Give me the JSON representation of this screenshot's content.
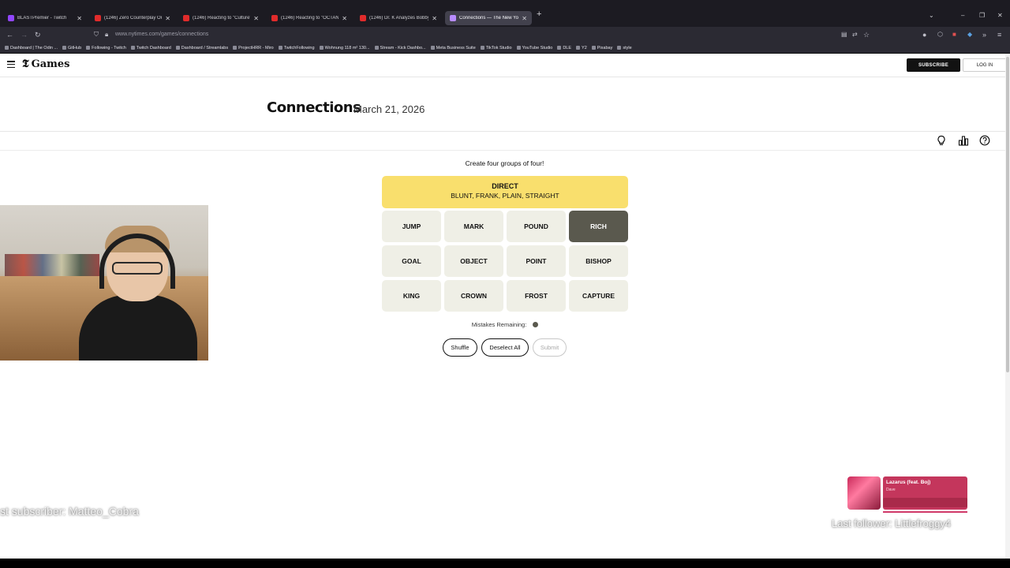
{
  "browser": {
    "tabs": [
      {
        "label": "BLASTPremier - Twitch",
        "icon": "twitch-icon",
        "active": false
      },
      {
        "label": "(1246) Zero Counterplay Oneshi",
        "icon": "youtube-icon",
        "active": false
      },
      {
        "label": "(1246) Reacting to \"Culture\" by",
        "icon": "youtube-icon",
        "active": false
      },
      {
        "label": "(1246) Reacting to \"OCTANE\" b",
        "icon": "youtube-icon",
        "active": false
      },
      {
        "label": "(1246) Dr. K Analyzes Bobby Le",
        "icon": "youtube-icon",
        "active": false
      },
      {
        "label": "Connections — The New York T",
        "icon": "nyt-games-icon",
        "active": true
      }
    ],
    "url": "www.nytimes.com/games/connections",
    "bookmarks": [
      "Dashboard | The Odin ...",
      "GitHub",
      "Following - Twitch",
      "Twitch Dashboard",
      "Dashboard / Streamlabs",
      "ProjectHRR - Miro",
      "TwitchFollowing",
      "Wohnung 118 m² 130...",
      "Stream - Kick Dashbo...",
      "Meta Business Suite",
      "TikTok Studio",
      "YouTube Studio",
      "DLE",
      "Y2",
      "Pixabay",
      "style"
    ]
  },
  "header": {
    "logo_text": "Games",
    "subscribe_label": "SUBSCRIBE",
    "login_label": "LOG IN"
  },
  "game": {
    "title": "Connections",
    "date": "March 21, 2026",
    "instructions": "Create four groups of four!",
    "solved_group": {
      "category": "DIRECT",
      "members": "BLUNT, FRANK, PLAIN, STRAIGHT",
      "color": "#f9df6d"
    },
    "tiles": [
      {
        "word": "JUMP",
        "selected": false
      },
      {
        "word": "MARK",
        "selected": false
      },
      {
        "word": "POUND",
        "selected": false
      },
      {
        "word": "RICH",
        "selected": true
      },
      {
        "word": "GOAL",
        "selected": false
      },
      {
        "word": "OBJECT",
        "selected": false
      },
      {
        "word": "POINT",
        "selected": false
      },
      {
        "word": "BISHOP",
        "selected": false
      },
      {
        "word": "KING",
        "selected": false
      },
      {
        "word": "CROWN",
        "selected": false
      },
      {
        "word": "FROST",
        "selected": false
      },
      {
        "word": "CAPTURE",
        "selected": false
      }
    ],
    "mistakes_label": "Mistakes Remaining:",
    "mistakes_remaining": 1,
    "buttons": {
      "shuffle": "Shuffle",
      "deselect": "Deselect All",
      "submit": "Submit"
    }
  },
  "overlay": {
    "sub_ticker": "st subscriber: Matteo_Cobra",
    "follower_ticker": "Last follower: Littlefroggy4",
    "now_playing": {
      "title": "Lazarus (feat. Boj)",
      "artist": "Dave"
    }
  },
  "colors": {
    "tile_bg": "#efefe6",
    "tile_selected": "#5a594e",
    "yellow_group": "#f9df6d"
  }
}
